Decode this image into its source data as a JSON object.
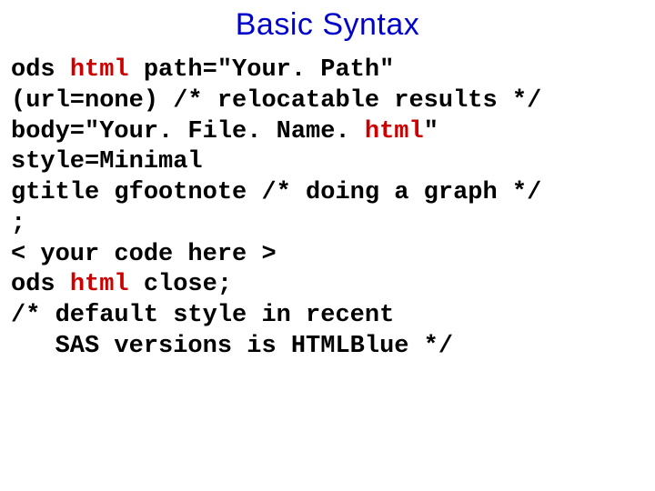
{
  "title": "Basic Syntax",
  "code": {
    "l1a": "ods ",
    "l1b": "html",
    "l1c": " path=\"Your. Path\"",
    "l2": "(url=none) /* relocatable results */",
    "l3a": "body=\"Your. File. Name. ",
    "l3b": "html",
    "l3c": "\"",
    "l4": "style=Minimal",
    "l5": "gtitle gfootnote /* doing a graph */",
    "l6": ";",
    "l7": "< your code here >",
    "l8a": "ods ",
    "l8b": "html",
    "l8c": " close;",
    "l9": "/* default style in recent",
    "l10": "   SAS versions is HTMLBlue */"
  }
}
